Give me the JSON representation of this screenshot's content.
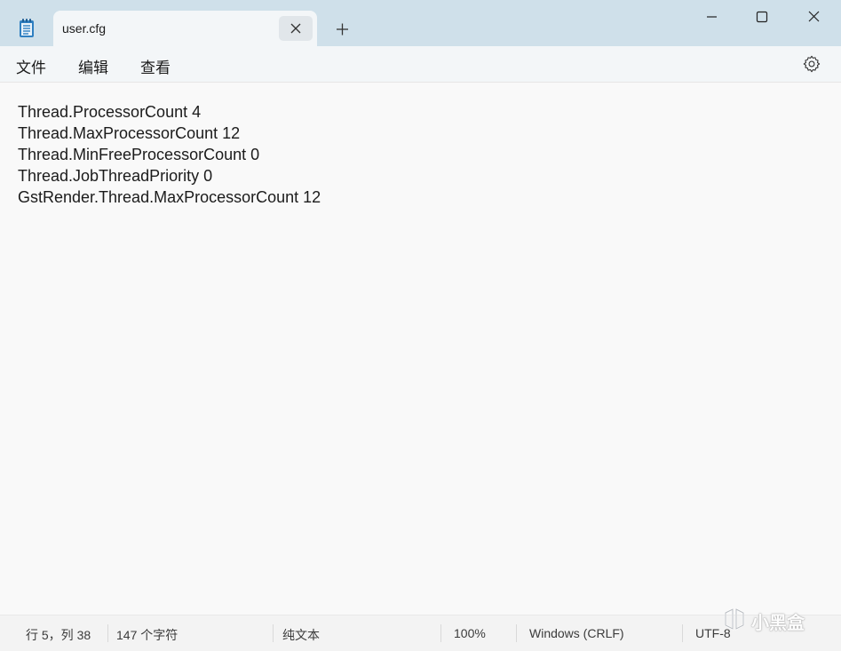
{
  "tab": {
    "title": "user.cfg"
  },
  "menu": {
    "file": "文件",
    "edit": "编辑",
    "view": "查看"
  },
  "editor": {
    "lines": [
      "Thread.ProcessorCount 4",
      "Thread.MaxProcessorCount 12",
      "Thread.MinFreeProcessorCount 0",
      "Thread.JobThreadPriority 0",
      "GstRender.Thread.MaxProcessorCount 12"
    ]
  },
  "status": {
    "position": "行 5，列 38",
    "char_count": "147 个字符",
    "format": "纯文本",
    "zoom": "100%",
    "line_ending": "Windows (CRLF)",
    "encoding": "UTF-8"
  },
  "watermark": {
    "text": "小黑盒"
  },
  "icons": {
    "app": "notepad-icon",
    "close_tab": "close-icon",
    "new_tab": "plus-icon",
    "minimize": "minimize-icon",
    "maximize": "maximize-icon",
    "close_window": "close-icon",
    "settings": "gear-icon"
  },
  "colors": {
    "titlebar": "#cfe0ea",
    "tab": "#f3f6f8",
    "editor_bg": "#f9f9f9",
    "statusbar": "#f3f3f3"
  }
}
